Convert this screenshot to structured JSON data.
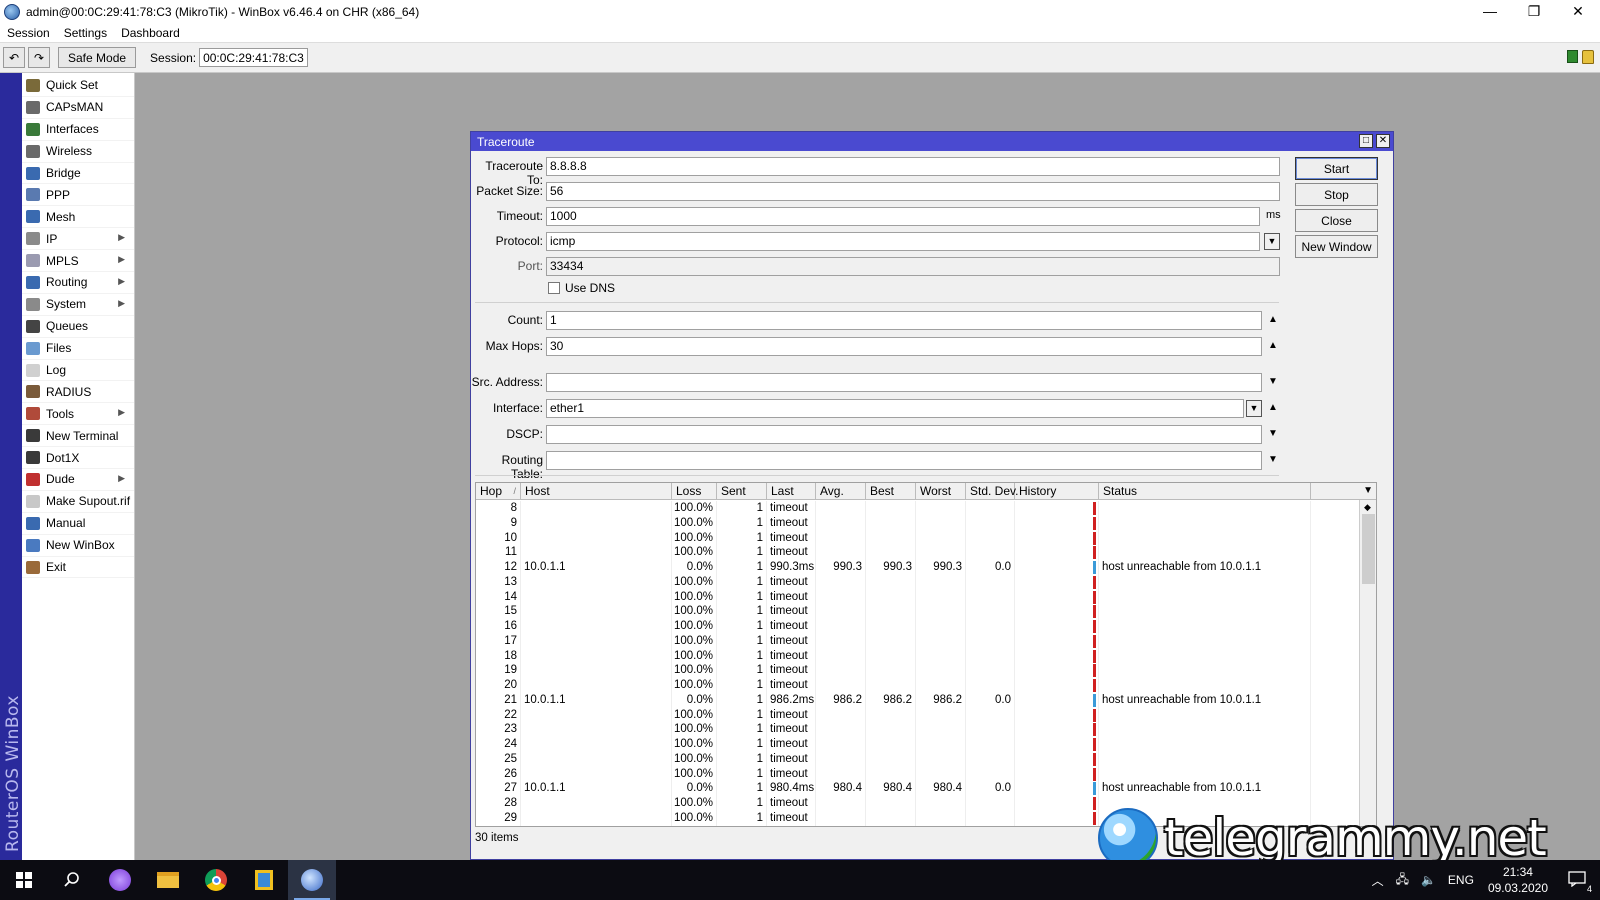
{
  "window": {
    "title": "admin@00:0C:29:41:78:C3 (MikroTik) - WinBox v6.46.4 on CHR (x86_64)",
    "minimize": "—",
    "restore": "❐",
    "close": "✕"
  },
  "menubar": [
    "Session",
    "Settings",
    "Dashboard"
  ],
  "toolbar": {
    "undo": "↶",
    "redo": "↷",
    "safe_mode": "Safe Mode",
    "session_label": "Session:",
    "session_value": "00:0C:29:41:78:C3"
  },
  "brand": "RouterOS WinBox",
  "sidebar": {
    "items": [
      {
        "label": "Quick Set",
        "icon": "wand-icon",
        "color": "#7a6a3a",
        "submenu": false
      },
      {
        "label": "CAPsMAN",
        "icon": "antenna-icon",
        "color": "#6a6a6a",
        "submenu": false
      },
      {
        "label": "Interfaces",
        "icon": "interfaces-icon",
        "color": "#3a7a3a",
        "submenu": false
      },
      {
        "label": "Wireless",
        "icon": "wireless-icon",
        "color": "#6a6a6a",
        "submenu": false
      },
      {
        "label": "Bridge",
        "icon": "bridge-icon",
        "color": "#3a6ab0",
        "submenu": false
      },
      {
        "label": "PPP",
        "icon": "ppp-icon",
        "color": "#5a7ab0",
        "submenu": false
      },
      {
        "label": "Mesh",
        "icon": "mesh-icon",
        "color": "#3a6ab0",
        "submenu": false
      },
      {
        "label": "IP",
        "icon": "ip-icon",
        "color": "#8a8a8a",
        "submenu": true
      },
      {
        "label": "MPLS",
        "icon": "mpls-icon",
        "color": "#9a9ab0",
        "submenu": true
      },
      {
        "label": "Routing",
        "icon": "routing-icon",
        "color": "#3a6ab0",
        "submenu": true
      },
      {
        "label": "System",
        "icon": "gear-icon",
        "color": "#8a8a8a",
        "submenu": true
      },
      {
        "label": "Queues",
        "icon": "queues-icon",
        "color": "#444444",
        "submenu": false
      },
      {
        "label": "Files",
        "icon": "folder-icon",
        "color": "#6a9ad0",
        "submenu": false
      },
      {
        "label": "Log",
        "icon": "log-icon",
        "color": "#d0d0d0",
        "submenu": false
      },
      {
        "label": "RADIUS",
        "icon": "radius-icon",
        "color": "#7a5a3a",
        "submenu": false
      },
      {
        "label": "Tools",
        "icon": "tools-icon",
        "color": "#b04a3a",
        "submenu": true
      },
      {
        "label": "New Terminal",
        "icon": "terminal-icon",
        "color": "#3a3a3a",
        "submenu": false
      },
      {
        "label": "Dot1X",
        "icon": "dot1x-icon",
        "color": "#3a3a3a",
        "submenu": false
      },
      {
        "label": "Dude",
        "icon": "dude-icon",
        "color": "#c03030",
        "submenu": true
      },
      {
        "label": "Make Supout.rif",
        "icon": "document-icon",
        "color": "#c8c8c8",
        "submenu": false
      },
      {
        "label": "Manual",
        "icon": "help-icon",
        "color": "#3a6ab0",
        "submenu": false
      },
      {
        "label": "New WinBox",
        "icon": "winbox-icon",
        "color": "#4a7ac0",
        "submenu": false
      },
      {
        "label": "Exit",
        "icon": "exit-icon",
        "color": "#9a6a3a",
        "submenu": false
      }
    ],
    "submenu_arrow": "▶"
  },
  "traceroute": {
    "title": "Traceroute",
    "fields": {
      "traceroute_to": {
        "label": "Traceroute To:",
        "value": "8.8.8.8"
      },
      "packet_size": {
        "label": "Packet Size:",
        "value": "56"
      },
      "timeout": {
        "label": "Timeout:",
        "value": "1000",
        "unit": "ms"
      },
      "protocol": {
        "label": "Protocol:",
        "value": "icmp"
      },
      "port": {
        "label": "Port:",
        "value": "33434"
      },
      "use_dns": {
        "label": "Use DNS",
        "checked": false
      },
      "count": {
        "label": "Count:",
        "value": "1"
      },
      "max_hops": {
        "label": "Max Hops:",
        "value": "30"
      },
      "src_address": {
        "label": "Src. Address:",
        "value": ""
      },
      "interface": {
        "label": "Interface:",
        "value": "ether1"
      },
      "dscp": {
        "label": "DSCP:",
        "value": ""
      },
      "routing_table": {
        "label": "Routing Table:",
        "value": ""
      }
    },
    "buttons": {
      "start": "Start",
      "stop": "Stop",
      "close": "Close",
      "new_window": "New Window"
    },
    "table": {
      "columns": [
        "Hop",
        "Host",
        "Loss",
        "Sent",
        "Last",
        "Avg.",
        "Best",
        "Worst",
        "Std. Dev.",
        "History",
        "Status"
      ],
      "sort_indicator": "/",
      "rows": [
        {
          "hop": "8",
          "host": "",
          "loss": "100.0%",
          "sent": "1",
          "last": "timeout",
          "avg": "",
          "best": "",
          "worst": "",
          "stdev": "",
          "hist": "red",
          "status": ""
        },
        {
          "hop": "9",
          "host": "",
          "loss": "100.0%",
          "sent": "1",
          "last": "timeout",
          "avg": "",
          "best": "",
          "worst": "",
          "stdev": "",
          "hist": "red",
          "status": ""
        },
        {
          "hop": "10",
          "host": "",
          "loss": "100.0%",
          "sent": "1",
          "last": "timeout",
          "avg": "",
          "best": "",
          "worst": "",
          "stdev": "",
          "hist": "red",
          "status": ""
        },
        {
          "hop": "11",
          "host": "",
          "loss": "100.0%",
          "sent": "1",
          "last": "timeout",
          "avg": "",
          "best": "",
          "worst": "",
          "stdev": "",
          "hist": "red",
          "status": ""
        },
        {
          "hop": "12",
          "host": "10.0.1.1",
          "loss": "0.0%",
          "sent": "1",
          "last": "990.3ms",
          "avg": "990.3",
          "best": "990.3",
          "worst": "990.3",
          "stdev": "0.0",
          "hist": "blue",
          "status": "host unreachable from 10.0.1.1"
        },
        {
          "hop": "13",
          "host": "",
          "loss": "100.0%",
          "sent": "1",
          "last": "timeout",
          "avg": "",
          "best": "",
          "worst": "",
          "stdev": "",
          "hist": "red",
          "status": ""
        },
        {
          "hop": "14",
          "host": "",
          "loss": "100.0%",
          "sent": "1",
          "last": "timeout",
          "avg": "",
          "best": "",
          "worst": "",
          "stdev": "",
          "hist": "red",
          "status": ""
        },
        {
          "hop": "15",
          "host": "",
          "loss": "100.0%",
          "sent": "1",
          "last": "timeout",
          "avg": "",
          "best": "",
          "worst": "",
          "stdev": "",
          "hist": "red",
          "status": ""
        },
        {
          "hop": "16",
          "host": "",
          "loss": "100.0%",
          "sent": "1",
          "last": "timeout",
          "avg": "",
          "best": "",
          "worst": "",
          "stdev": "",
          "hist": "red",
          "status": ""
        },
        {
          "hop": "17",
          "host": "",
          "loss": "100.0%",
          "sent": "1",
          "last": "timeout",
          "avg": "",
          "best": "",
          "worst": "",
          "stdev": "",
          "hist": "red",
          "status": ""
        },
        {
          "hop": "18",
          "host": "",
          "loss": "100.0%",
          "sent": "1",
          "last": "timeout",
          "avg": "",
          "best": "",
          "worst": "",
          "stdev": "",
          "hist": "red",
          "status": ""
        },
        {
          "hop": "19",
          "host": "",
          "loss": "100.0%",
          "sent": "1",
          "last": "timeout",
          "avg": "",
          "best": "",
          "worst": "",
          "stdev": "",
          "hist": "red",
          "status": ""
        },
        {
          "hop": "20",
          "host": "",
          "loss": "100.0%",
          "sent": "1",
          "last": "timeout",
          "avg": "",
          "best": "",
          "worst": "",
          "stdev": "",
          "hist": "red",
          "status": ""
        },
        {
          "hop": "21",
          "host": "10.0.1.1",
          "loss": "0.0%",
          "sent": "1",
          "last": "986.2ms",
          "avg": "986.2",
          "best": "986.2",
          "worst": "986.2",
          "stdev": "0.0",
          "hist": "blue",
          "status": "host unreachable from 10.0.1.1"
        },
        {
          "hop": "22",
          "host": "",
          "loss": "100.0%",
          "sent": "1",
          "last": "timeout",
          "avg": "",
          "best": "",
          "worst": "",
          "stdev": "",
          "hist": "red",
          "status": ""
        },
        {
          "hop": "23",
          "host": "",
          "loss": "100.0%",
          "sent": "1",
          "last": "timeout",
          "avg": "",
          "best": "",
          "worst": "",
          "stdev": "",
          "hist": "red",
          "status": ""
        },
        {
          "hop": "24",
          "host": "",
          "loss": "100.0%",
          "sent": "1",
          "last": "timeout",
          "avg": "",
          "best": "",
          "worst": "",
          "stdev": "",
          "hist": "red",
          "status": ""
        },
        {
          "hop": "25",
          "host": "",
          "loss": "100.0%",
          "sent": "1",
          "last": "timeout",
          "avg": "",
          "best": "",
          "worst": "",
          "stdev": "",
          "hist": "red",
          "status": ""
        },
        {
          "hop": "26",
          "host": "",
          "loss": "100.0%",
          "sent": "1",
          "last": "timeout",
          "avg": "",
          "best": "",
          "worst": "",
          "stdev": "",
          "hist": "red",
          "status": ""
        },
        {
          "hop": "27",
          "host": "10.0.1.1",
          "loss": "0.0%",
          "sent": "1",
          "last": "980.4ms",
          "avg": "980.4",
          "best": "980.4",
          "worst": "980.4",
          "stdev": "0.0",
          "hist": "blue",
          "status": "host unreachable from 10.0.1.1"
        },
        {
          "hop": "28",
          "host": "",
          "loss": "100.0%",
          "sent": "1",
          "last": "timeout",
          "avg": "",
          "best": "",
          "worst": "",
          "stdev": "",
          "hist": "red",
          "status": ""
        },
        {
          "hop": "29",
          "host": "",
          "loss": "100.0%",
          "sent": "1",
          "last": "timeout",
          "avg": "",
          "best": "",
          "worst": "",
          "stdev": "",
          "hist": "red",
          "status": ""
        }
      ],
      "items_count": "30 items"
    }
  },
  "colors": {
    "history_red": "#d02020",
    "history_blue": "#3a9ad8",
    "window_title": "#4a4ad0",
    "brand_bar": "#2a2a9c"
  },
  "watermark": "telegrammy.net",
  "taskbar": {
    "icons": [
      "windows-start-icon",
      "search-icon",
      "assistant-icon",
      "file-explorer-icon",
      "chrome-icon",
      "notes-app-icon",
      "winbox-icon"
    ],
    "tray": {
      "language": "ENG",
      "time": "21:34",
      "date": "09.03.2020",
      "notifications": "4"
    }
  }
}
